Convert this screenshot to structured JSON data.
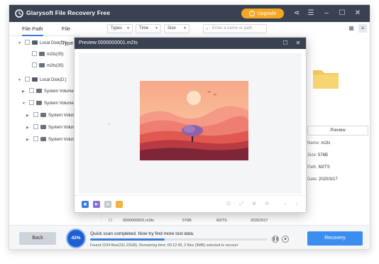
{
  "app": {
    "title": "Glarysoft File Recovery Free",
    "upgrade_label": "Upgrade"
  },
  "titlebar_icons": [
    "share-icon",
    "menu-icon",
    "minimize-icon",
    "maximize-icon",
    "close-icon"
  ],
  "tabs": [
    {
      "label": "File Path",
      "active": true
    },
    {
      "label": "File Type",
      "active": false
    }
  ],
  "filters": {
    "types": "Types",
    "time": "Time",
    "size": "Size",
    "search_placeholder": "Enter a name or path"
  },
  "tree": [
    {
      "label": "Local Disk(D:)",
      "level": 0,
      "kind": "disk"
    },
    {
      "label": "m2ts(35)",
      "level": 1,
      "kind": "folder"
    },
    {
      "label": "m2ts(35)",
      "level": 1,
      "kind": "folder"
    },
    {
      "label": "Local Disk(D:)",
      "level": 0,
      "kind": "disk"
    },
    {
      "label": "System Volume",
      "level": 1,
      "kind": "folder"
    },
    {
      "label": "System Volume",
      "level": 1,
      "kind": "folder"
    },
    {
      "label": "System Volum",
      "level": 2,
      "kind": "folder"
    },
    {
      "label": "System Volum",
      "level": 2,
      "kind": "folder"
    },
    {
      "label": "System Volum",
      "level": 2,
      "kind": "folder"
    }
  ],
  "details": {
    "preview_label": "Preview",
    "name_label": "Name:",
    "name_value": "m2ts",
    "size_label": "Size:",
    "size_value": "576B",
    "path_label": "Path:",
    "path_value": "M2TS",
    "date_label": "Date:",
    "date_value": "2020/3/17"
  },
  "list_rows": [
    {
      "name": "0000000001.m2ts",
      "size": "576B",
      "type": "M2TS",
      "date": "2020/3/17"
    },
    {
      "name": "0000000001.m2ts",
      "size": "576B",
      "type": "M2TS",
      "date": "2020/3/17"
    }
  ],
  "preview_dialog": {
    "title": "Preview 0000000001.m2ts"
  },
  "bottom": {
    "back_label": "Back",
    "progress_percent": 42,
    "progress_label": "42%",
    "message": "Quick scan completed. Now try find more lost data.",
    "status": "Found:1234 files(311.23GB), Remaining time: 00:12:45, 2 files (5MB) selected to recover",
    "recovery_label": "Recovery"
  },
  "colors": {
    "titlebar": "#3a4150",
    "accent": "#3b7ddd",
    "upgrade": "#f5a623",
    "recovery": "#3b8ef0"
  }
}
